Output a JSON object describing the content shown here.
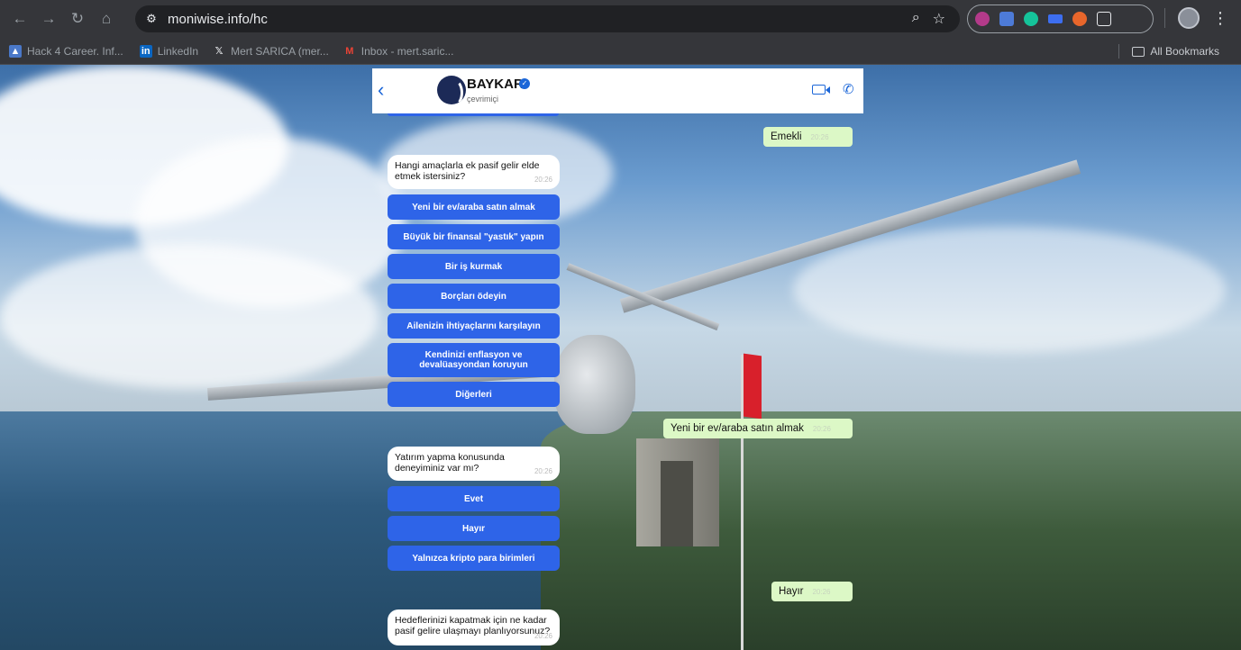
{
  "browser": {
    "url": "moniwise.info/hc",
    "bookmarks": [
      {
        "label": "Hack 4 Career. Inf...",
        "icon": "hack4career-icon"
      },
      {
        "label": "LinkedIn",
        "icon": "linkedin-icon"
      },
      {
        "label": "Mert SARICA (mer...",
        "icon": "x-icon"
      },
      {
        "label": "Inbox - mert.saric...",
        "icon": "gmail-icon"
      }
    ],
    "all_bookmarks_label": "All Bookmarks"
  },
  "chat": {
    "brand_name": "BAYKAR",
    "status": "çevrimiçi",
    "messages_in": [
      {
        "text": "Hangi amaçlarla ek pasif gelir elde etmek istersiniz?",
        "time": "20:26"
      },
      {
        "text": "Yatırım yapma konusunda deneyiminiz var mı?",
        "time": "20:26"
      },
      {
        "text": "Hedeflerinizi kapatmak için ne kadar pasif gelire ulaşmayı planlıyorsunuz?",
        "time": "20:26"
      }
    ],
    "options_group1": [
      "Yeni bir ev/araba satın almak",
      "Büyük bir finansal \"yastık\" yapın",
      "Bir iş kurmak",
      "Borçları ödeyin",
      "Ailenizin ihtiyaçlarını karşılayın",
      "Kendinizi enflasyon ve devalüasyondan koruyun",
      "Diğerleri"
    ],
    "options_group2": [
      "Evet",
      "Hayır",
      "Yalnızca kripto para birimleri"
    ],
    "messages_out": [
      {
        "text": "Emekli",
        "time": "20:26"
      },
      {
        "text": "Yeni bir ev/araba satın almak",
        "time": "20:26"
      },
      {
        "text": "Hayır",
        "time": "20:26"
      }
    ]
  },
  "colors": {
    "accent": "#2e64e8",
    "outgoing_bubble": "#dcf8c6",
    "chrome_bg": "#35363a"
  }
}
